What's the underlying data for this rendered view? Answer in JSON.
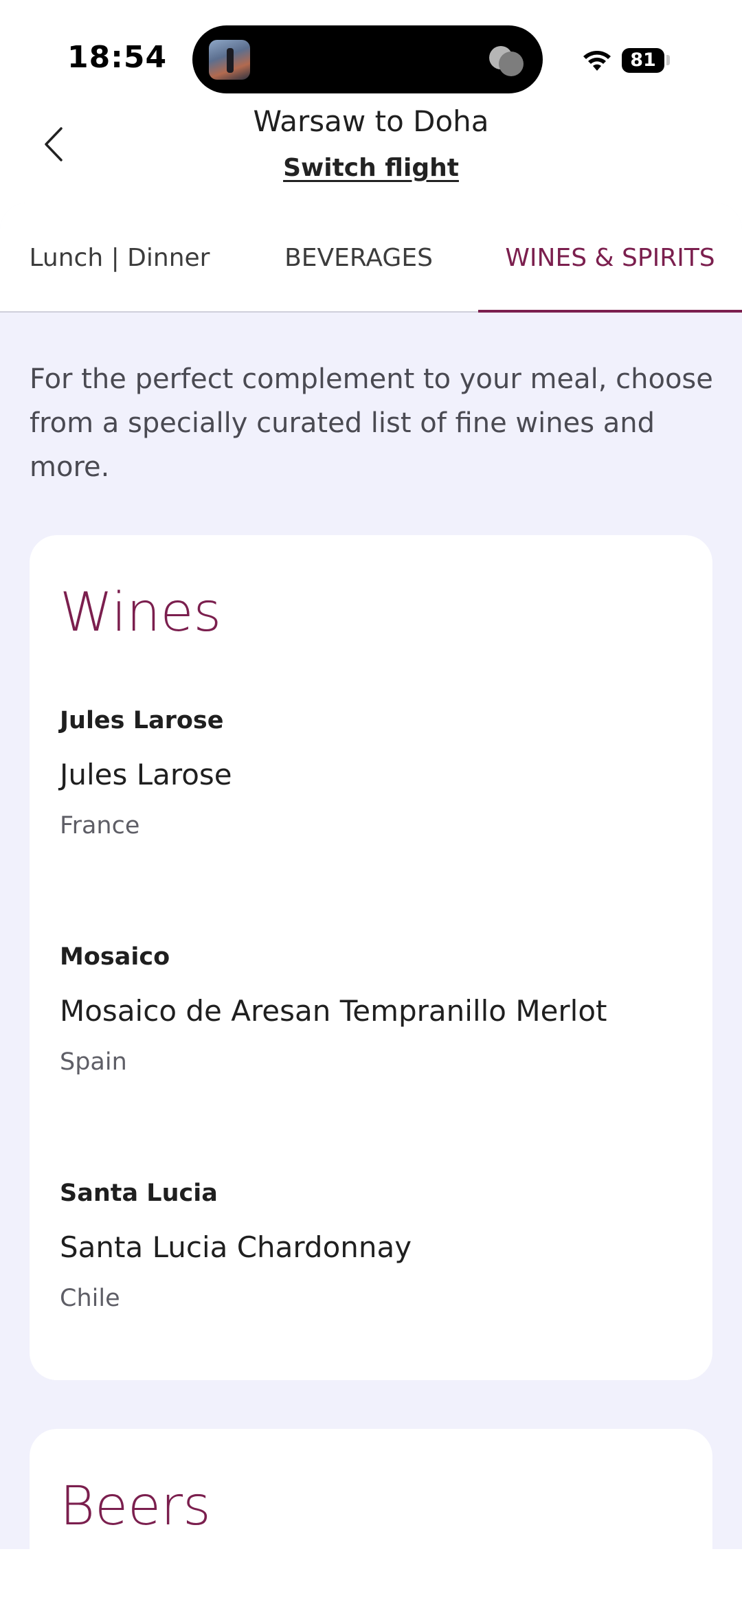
{
  "status_bar": {
    "time": "18:54",
    "battery": "81",
    "icons": [
      "wifi-icon",
      "battery-icon"
    ]
  },
  "header": {
    "title": "Warsaw to Doha",
    "switch_label": "Switch flight",
    "back_icon": "chevron-left-icon"
  },
  "tabs": [
    {
      "label": "Lunch | Dinner",
      "active": false
    },
    {
      "label": "BEVERAGES",
      "active": false
    },
    {
      "label": "WINES & SPIRITS",
      "active": true
    }
  ],
  "intro": "For the perfect complement to your meal, choose from a specially curated list of fine wines and more.",
  "sections": {
    "wines": {
      "title": "Wines",
      "items": [
        {
          "brand": "Jules Larose",
          "name": "Jules Larose",
          "country": "France"
        },
        {
          "brand": "Mosaico",
          "name": "Mosaico de Aresan Tempranillo Merlot",
          "country": "Spain"
        },
        {
          "brand": "Santa Lucia",
          "name": "Santa Lucia Chardonnay",
          "country": "Chile"
        }
      ]
    },
    "beers": {
      "title": "Beers"
    }
  },
  "colors": {
    "accent": "#7b1f4e",
    "background": "#f1f1fc",
    "card": "#ffffff"
  }
}
